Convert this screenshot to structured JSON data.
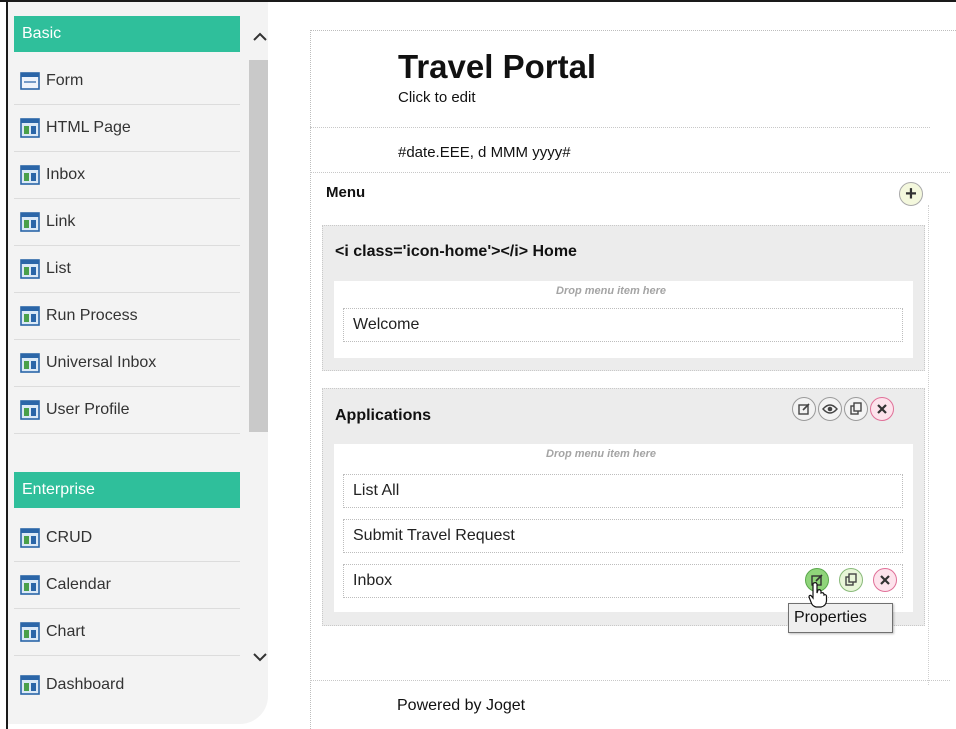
{
  "sidebar": {
    "categories": [
      {
        "name": "Basic",
        "items": [
          {
            "label": "Form",
            "icon": "form-icon"
          },
          {
            "label": "HTML Page",
            "icon": "page-icon"
          },
          {
            "label": "Inbox",
            "icon": "page-icon"
          },
          {
            "label": "Link",
            "icon": "page-icon"
          },
          {
            "label": "List",
            "icon": "page-icon"
          },
          {
            "label": "Run Process",
            "icon": "page-icon"
          },
          {
            "label": "Universal Inbox",
            "icon": "page-icon"
          },
          {
            "label": "User Profile",
            "icon": "page-icon"
          }
        ]
      },
      {
        "name": "Enterprise",
        "items": [
          {
            "label": "CRUD",
            "icon": "page-icon"
          },
          {
            "label": "Calendar",
            "icon": "page-icon"
          },
          {
            "label": "Chart",
            "icon": "page-icon"
          },
          {
            "label": "Dashboard",
            "icon": "page-icon"
          }
        ]
      }
    ],
    "accent_color": "#2fbf9b"
  },
  "canvas": {
    "title": "Travel Portal",
    "subtitle": "Click to edit",
    "date_format": "#date.EEE, d MMM yyyy#",
    "menu_label": "Menu",
    "groups": [
      {
        "title": "<i class='icon-home'></i> Home",
        "drop_hint": "Drop menu item here",
        "items": [
          "Welcome"
        ]
      },
      {
        "title": "Applications",
        "drop_hint": "Drop menu item here",
        "items": [
          "List All",
          "Submit Travel Request",
          "Inbox"
        ]
      }
    ],
    "tooltip": "Properties",
    "footer": "Powered by Joget"
  }
}
